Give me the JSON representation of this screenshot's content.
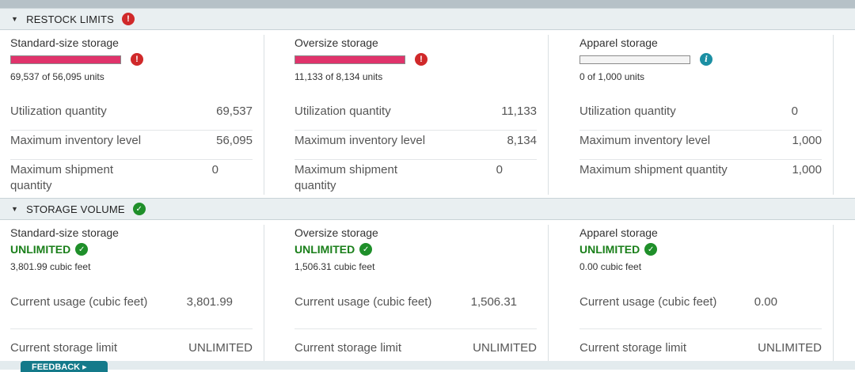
{
  "restock": {
    "title": "RESTOCK LIMITS",
    "columns": [
      {
        "name": "Standard-size storage",
        "bar_fill": 1.0,
        "bar_color": "#e0336b",
        "status_icon": "error-icon",
        "units_text": "69,537 of 56,095 units",
        "rows": [
          {
            "label": "Utilization quantity",
            "value": "69,537"
          },
          {
            "label": "Maximum inventory level",
            "value": "56,095"
          },
          {
            "label": "Maximum shipment quantity",
            "value": "0"
          }
        ]
      },
      {
        "name": "Oversize storage",
        "bar_fill": 1.0,
        "bar_color": "#e0336b",
        "status_icon": "error-icon",
        "units_text": "11,133 of 8,134 units",
        "rows": [
          {
            "label": "Utilization quantity",
            "value": "11,133"
          },
          {
            "label": "Maximum inventory level",
            "value": "8,134"
          },
          {
            "label": "Maximum shipment quantity",
            "value": "0"
          }
        ]
      },
      {
        "name": "Apparel storage",
        "bar_fill": 0.0,
        "bar_color": "#e0336b",
        "status_icon": "info-icon",
        "units_text": "0 of 1,000 units",
        "rows": [
          {
            "label": "Utilization quantity",
            "value": "0"
          },
          {
            "label": "Maximum inventory level",
            "value": "1,000"
          },
          {
            "label": "Maximum shipment quantity",
            "value": "1,000"
          }
        ]
      }
    ]
  },
  "volume": {
    "title": "STORAGE VOLUME",
    "columns": [
      {
        "name": "Standard-size storage",
        "status": "UNLIMITED",
        "cubic_text": "3,801.99 cubic feet",
        "rows": [
          {
            "label": "Current usage (cubic feet)",
            "value": "3,801.99"
          },
          {
            "label": "Current storage limit",
            "value": "UNLIMITED"
          }
        ]
      },
      {
        "name": "Oversize storage",
        "status": "UNLIMITED",
        "cubic_text": "1,506.31 cubic feet",
        "rows": [
          {
            "label": "Current usage (cubic feet)",
            "value": "1,506.31"
          },
          {
            "label": "Current storage limit",
            "value": "UNLIMITED"
          }
        ]
      },
      {
        "name": "Apparel storage",
        "status": "UNLIMITED",
        "cubic_text": "0.00 cubic feet",
        "rows": [
          {
            "label": "Current usage (cubic feet)",
            "value": "0.00"
          },
          {
            "label": "Current storage limit",
            "value": "UNLIMITED"
          }
        ]
      }
    ]
  },
  "icons": {
    "caret": "▼",
    "error": "!",
    "ok": "✓",
    "info": "i"
  },
  "feedback": {
    "label": "FEEDBACK ▸"
  },
  "colors": {
    "header_bg": "#e9eff1",
    "error": "#d0292a",
    "ok": "#1f8f2a",
    "info": "#1b8fa3",
    "bar_fill": "#e0336b",
    "unlimited_text": "#1a7f1a",
    "feedback_bg": "#147a8a"
  }
}
